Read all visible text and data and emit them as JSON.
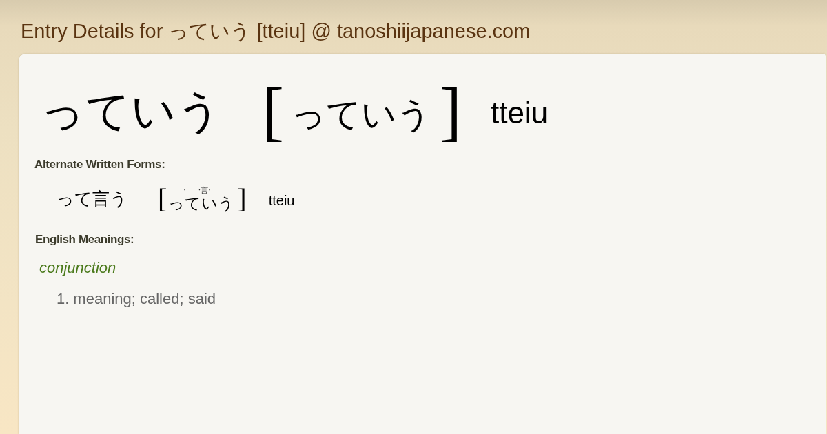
{
  "page_title": "Entry Details for っていう [tteiu] @ tanoshiijapanese.com",
  "entry": {
    "word": "っていう",
    "open_bracket": "[",
    "reading": "っていう",
    "close_bracket": "]",
    "romaji": "tteiu"
  },
  "alternate_forms": {
    "heading": "Alternate Written Forms:",
    "items": [
      {
        "word": "って言う",
        "open_bracket": "[",
        "reading_marks": [
          "·",
          "·言·"
        ],
        "reading": "っていう",
        "close_bracket": "]",
        "romaji": "tteiu"
      }
    ]
  },
  "meanings": {
    "heading": "English Meanings:",
    "groups": [
      {
        "part_of_speech": "conjunction",
        "senses": [
          {
            "number": "1.",
            "text": "meaning; called; said"
          }
        ]
      }
    ]
  }
}
